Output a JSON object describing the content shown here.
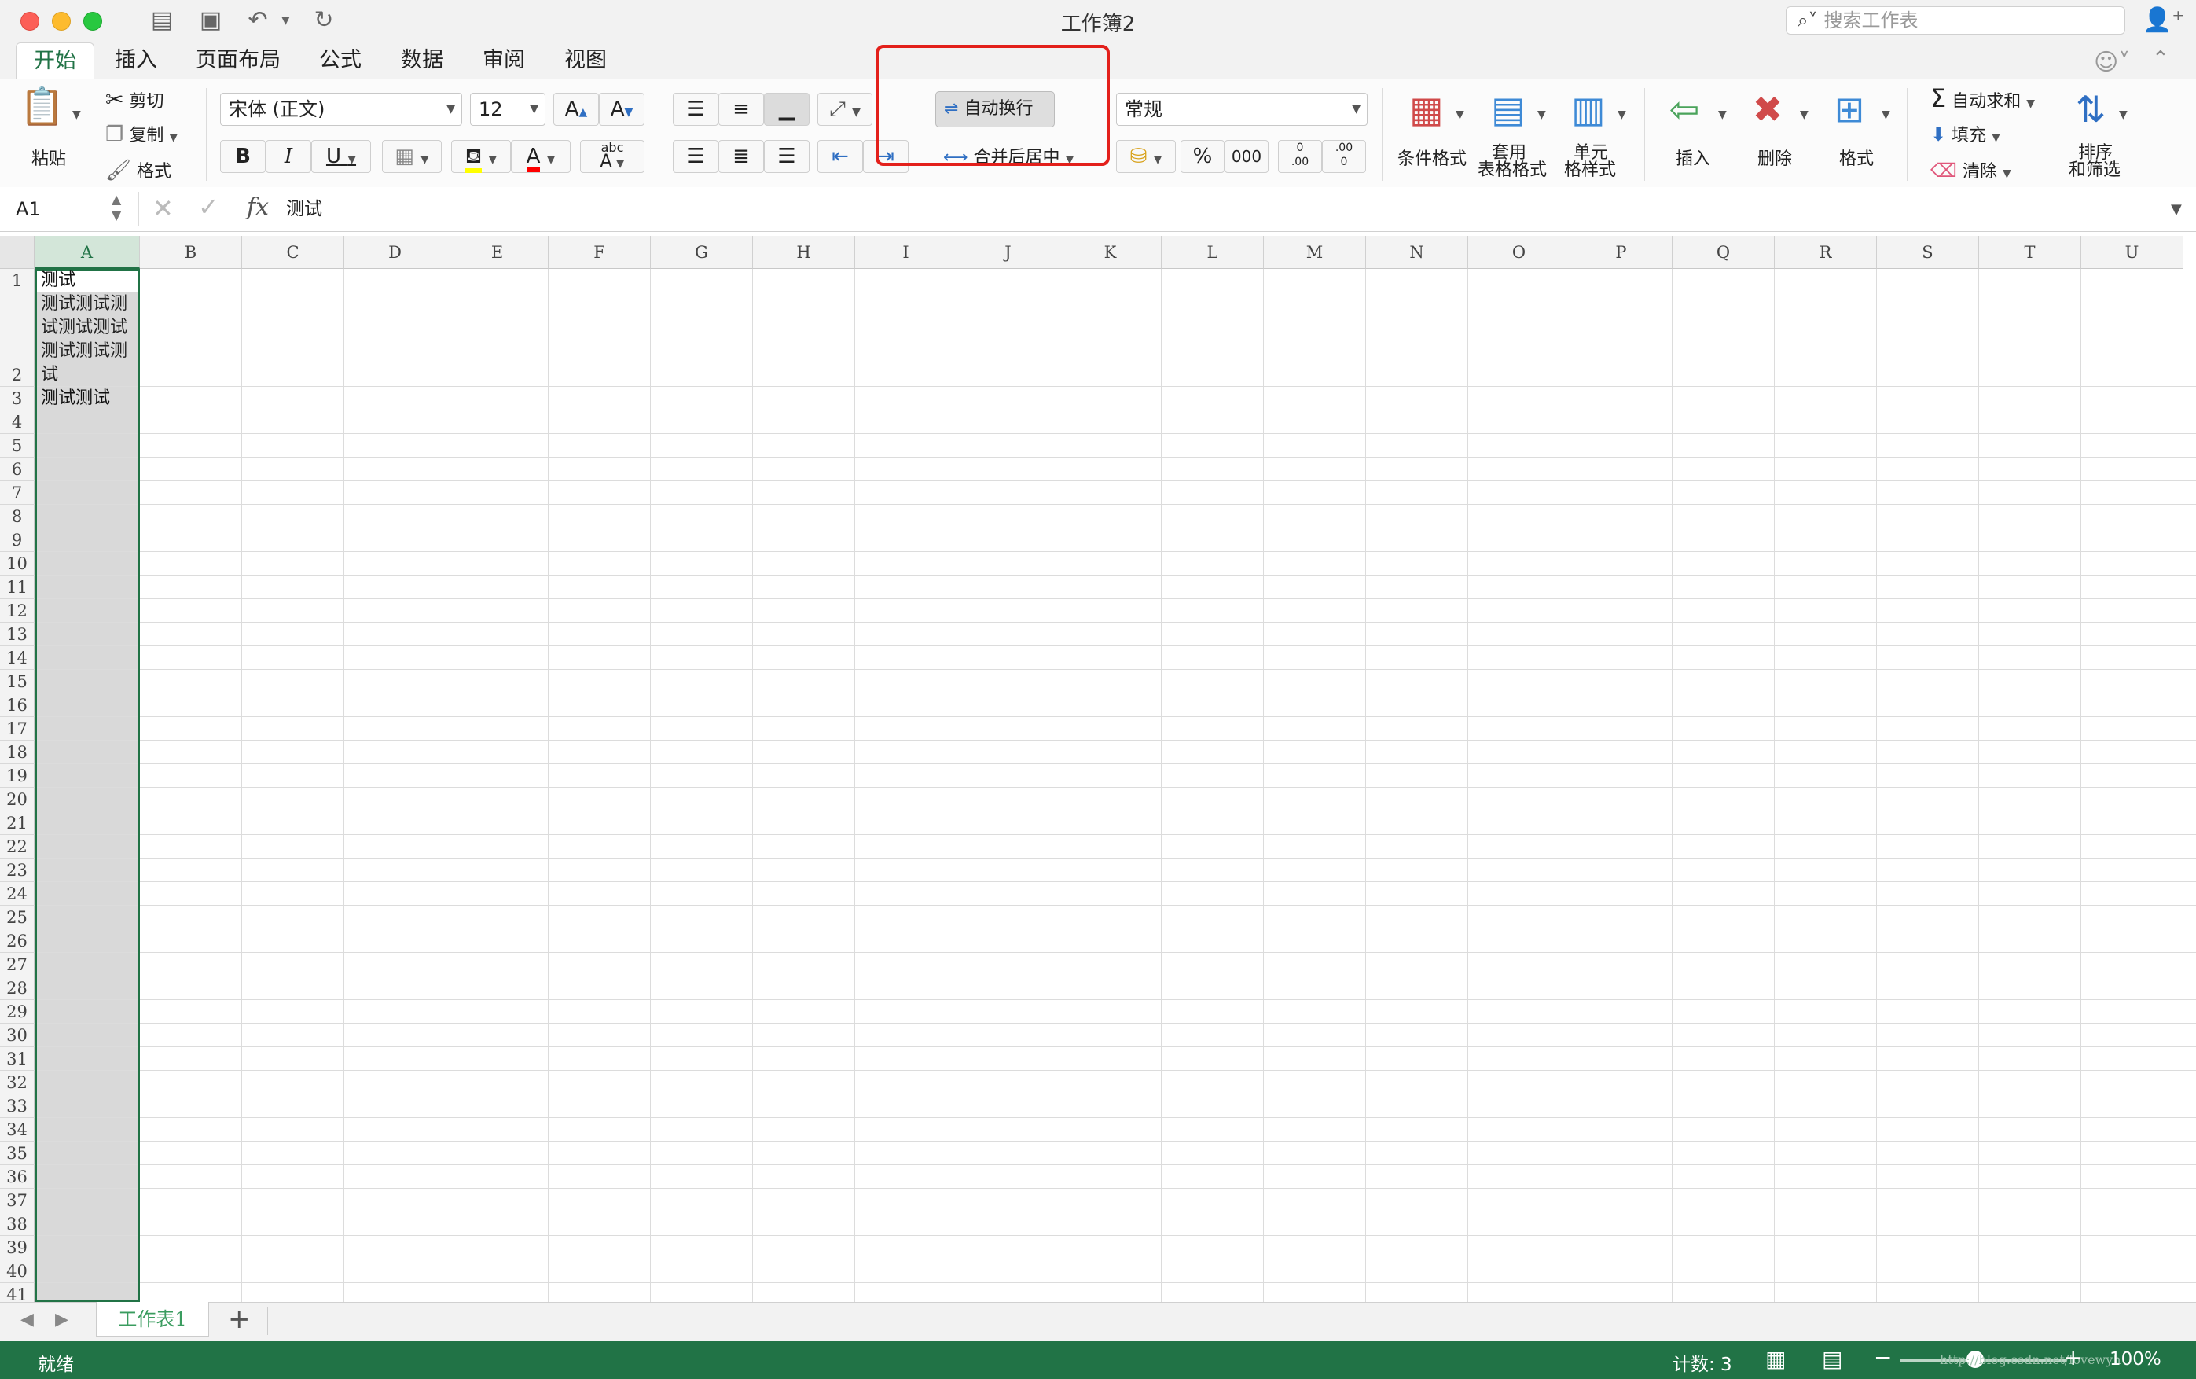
{
  "window": {
    "title": "工作簿2"
  },
  "search": {
    "placeholder": "搜索工作表"
  },
  "ribbon_tabs": [
    "开始",
    "插入",
    "页面布局",
    "公式",
    "数据",
    "审阅",
    "视图"
  ],
  "clipboard": {
    "paste": "粘贴",
    "cut": "剪切",
    "copy": "复制",
    "format": "格式"
  },
  "font": {
    "name": "宋体 (正文)",
    "size": "12",
    "bold": "B",
    "italic": "I",
    "underline": "U",
    "grow": "A",
    "shrink": "A",
    "color_letter": "A",
    "phonetic_top": "abc",
    "phonetic_bottom": "A"
  },
  "alignment": {
    "wrap_text": "自动换行",
    "merge_center": "合并后居中"
  },
  "number": {
    "format": "常规",
    "percent": "%",
    "thousands": "000",
    "inc_top": "0",
    "inc_bottom": ".00",
    "dec_top": ".00",
    "dec_bottom": "0"
  },
  "styles": {
    "conditional": "条件格式",
    "table_line1": "套用",
    "table_line2": "表格格式",
    "cell_line1": "单元",
    "cell_line2": "格样式"
  },
  "cells": {
    "insert": "插入",
    "delete": "删除",
    "format": "格式"
  },
  "editing": {
    "autosum": "自动求和",
    "fill": "填充",
    "clear": "清除",
    "sort_line1": "排序",
    "sort_line2": "和筛选"
  },
  "formula_bar": {
    "name_box": "A1",
    "fx": "fx",
    "content": "测试"
  },
  "grid": {
    "columns": [
      "A",
      "B",
      "C",
      "D",
      "E",
      "F",
      "G",
      "H",
      "I",
      "J",
      "K",
      "L",
      "M",
      "N",
      "O",
      "P",
      "Q",
      "R",
      "S",
      "T",
      "U"
    ],
    "rows": [
      "1",
      "2",
      "3",
      "4",
      "5",
      "6",
      "7",
      "8",
      "9",
      "10",
      "11",
      "12",
      "13",
      "14",
      "15",
      "16",
      "17",
      "18",
      "19",
      "20",
      "21",
      "22",
      "23",
      "24",
      "25",
      "26",
      "27",
      "28",
      "29",
      "30",
      "31",
      "32",
      "33",
      "34",
      "35",
      "36",
      "37",
      "38",
      "39",
      "40",
      "41"
    ],
    "a1": "测试",
    "a2": [
      "测试测试测",
      "试测试测试",
      "测试测试测",
      "试"
    ],
    "a3": "测试测试"
  },
  "sheets": {
    "active": "工作表1",
    "add": "+"
  },
  "status": {
    "ready": "就绪",
    "count": "计数: 3",
    "zoom": "100%",
    "watermark": "http://blog.csdn.net/lovewyh"
  },
  "colors": {
    "accent": "#217346",
    "highlight": "#e3201b"
  }
}
